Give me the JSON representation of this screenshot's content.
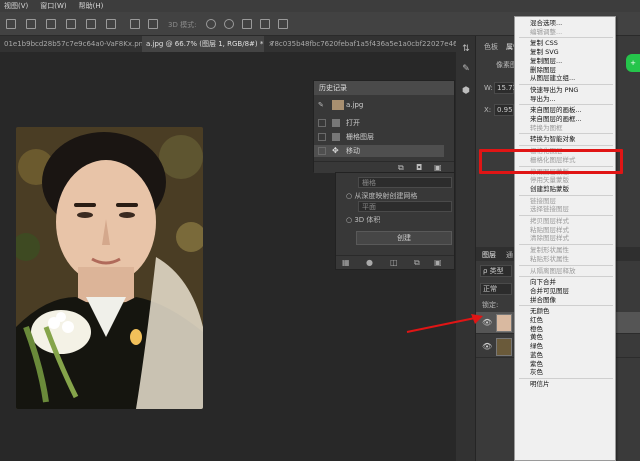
{
  "menubar": {
    "items": [
      "视图(V)",
      "窗口(W)",
      "帮助(H)"
    ]
  },
  "optbar": {
    "label_3d": "3D 模式:"
  },
  "tabs": [
    {
      "label": "01e1b9bcd28b57c7e9c64a0-VaF8Kx.png",
      "active": false
    },
    {
      "label": "a.jpg @ 66.7% (图层 1, RGB/8#) *",
      "active": true
    },
    {
      "label": "78c035b48fbc7620febaf1a5f436a5e1a0cbf22027e46",
      "active": false
    }
  ],
  "history": {
    "title": "历史记录",
    "snapshot": "a.jpg",
    "rows": [
      "打开",
      "栅格图层",
      "移动"
    ]
  },
  "panel3d": {
    "input1": "栅格",
    "row1": "从深度映射创建网格",
    "input2": "平面",
    "row2": "3D 体积",
    "create_button": "创建"
  },
  "properties": {
    "tab1": "色板",
    "tab2": "属性",
    "row": "像素图",
    "w_label": "W:",
    "w_value": "15.73",
    "x_label": "X:",
    "x_value": "0.95"
  },
  "layers": {
    "tab1": "图层",
    "tab2": "通",
    "filter": "ρ 类型",
    "blend": "正常",
    "lock": "锁定:"
  },
  "context_menu": {
    "items": [
      {
        "label": "混合选项...",
        "disabled": false
      },
      {
        "label": "编辑调整...",
        "disabled": true
      },
      {
        "sep": true
      },
      {
        "label": "复制 CSS",
        "disabled": false
      },
      {
        "label": "复制 SVG",
        "disabled": false
      },
      {
        "label": "复制图层...",
        "disabled": false
      },
      {
        "label": "删除图层",
        "disabled": false
      },
      {
        "label": "从图层建立组...",
        "disabled": false
      },
      {
        "sep": true
      },
      {
        "label": "快速导出为 PNG",
        "disabled": false
      },
      {
        "label": "导出为...",
        "disabled": false
      },
      {
        "sep": true
      },
      {
        "label": "来自图层的画板...",
        "disabled": false
      },
      {
        "label": "来自图层的画框...",
        "disabled": false
      },
      {
        "label": "转换为图框",
        "disabled": true
      },
      {
        "sep": true
      },
      {
        "label": "转换为智能对象",
        "disabled": false,
        "highlight": true
      },
      {
        "sep": true
      },
      {
        "label": "栅格化图层",
        "disabled": true
      },
      {
        "label": "栅格化图层样式",
        "disabled": true
      },
      {
        "sep": true
      },
      {
        "label": "停用图层蒙版",
        "disabled": true
      },
      {
        "label": "停用矢量蒙版",
        "disabled": true
      },
      {
        "label": "创建剪贴蒙版",
        "disabled": false
      },
      {
        "sep": true
      },
      {
        "label": "链接图层",
        "disabled": true
      },
      {
        "label": "选择链接图层",
        "disabled": true
      },
      {
        "sep": true
      },
      {
        "label": "拷贝图层样式",
        "disabled": true
      },
      {
        "label": "粘贴图层样式",
        "disabled": true
      },
      {
        "label": "清除图层样式",
        "disabled": true
      },
      {
        "sep": true
      },
      {
        "label": "复制形状属性",
        "disabled": true
      },
      {
        "label": "粘贴形状属性",
        "disabled": true
      },
      {
        "sep": true
      },
      {
        "label": "从隔离图层释放",
        "disabled": true
      },
      {
        "sep": true
      },
      {
        "label": "向下合并",
        "disabled": false
      },
      {
        "label": "合并可见图层",
        "disabled": false
      },
      {
        "label": "拼合图像",
        "disabled": false
      },
      {
        "sep": true
      },
      {
        "label": "无颜色",
        "disabled": false
      },
      {
        "label": "红色",
        "disabled": false
      },
      {
        "label": "橙色",
        "disabled": false
      },
      {
        "label": "黄色",
        "disabled": false
      },
      {
        "label": "绿色",
        "disabled": false
      },
      {
        "label": "蓝色",
        "disabled": false
      },
      {
        "label": "紫色",
        "disabled": false
      },
      {
        "label": "灰色",
        "disabled": false
      },
      {
        "sep": true
      },
      {
        "label": "明信片",
        "disabled": false
      }
    ]
  },
  "colors": {
    "highlight_box": "#e01515",
    "arrow": "#e01515",
    "badge": "#25c54b"
  }
}
